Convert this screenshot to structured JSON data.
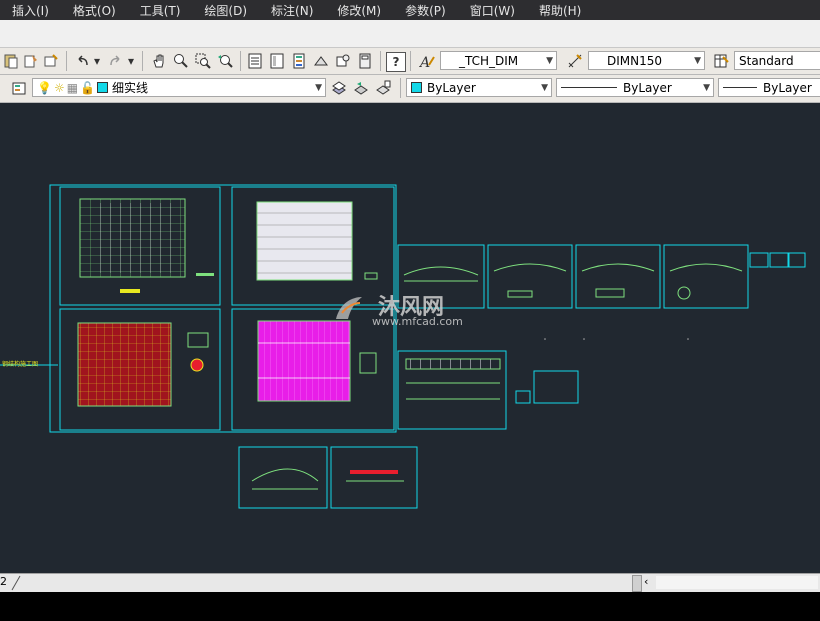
{
  "menu": [
    "插入(I)",
    "格式(O)",
    "工具(T)",
    "绘图(D)",
    "标注(N)",
    "修改(M)",
    "参数(P)",
    "窗口(W)",
    "帮助(H)"
  ],
  "toolbar": {
    "text_style": "_TCH_DIM",
    "dim_style": "DIMN150",
    "table_style": "Standard"
  },
  "layers": {
    "current_layer": "细实线",
    "color": "ByLayer",
    "linetype": "ByLayer",
    "lineweight": "ByLayer"
  },
  "canvas": {
    "left_label": "钢结构施工图",
    "watermark_cn": "沐风网",
    "watermark_url": "www.mfcad.com"
  },
  "tabs": {
    "current": "2"
  },
  "colors": {
    "background": "#212830",
    "sheet_border": "#13d8e8",
    "drawing_green": "#7ee07e",
    "magenta_fill": "#e81ee8",
    "red_fill": "#a0141e"
  }
}
